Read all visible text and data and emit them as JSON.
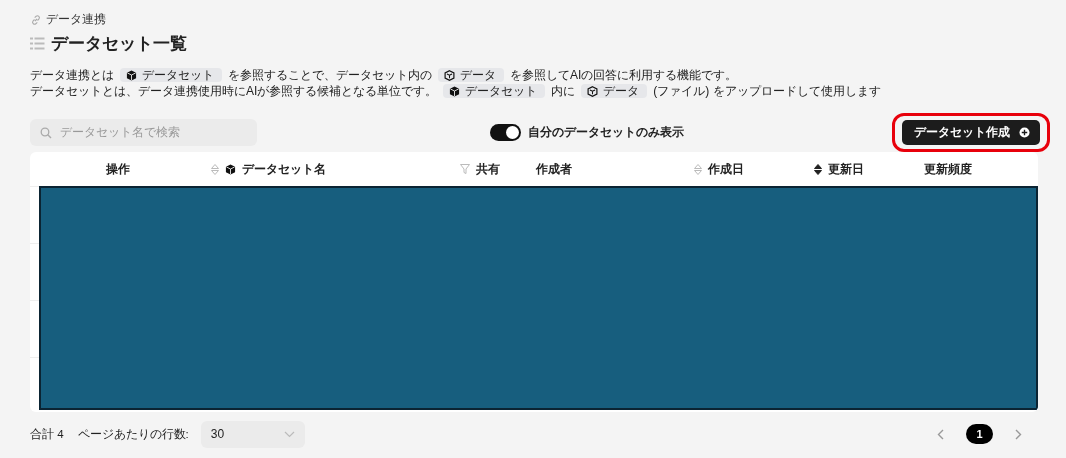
{
  "breadcrumb": "データ連携",
  "title": "データセット一覧",
  "description": [
    [
      {
        "kind": "text",
        "text": "データ連携とは"
      },
      {
        "kind": "dataset",
        "text": "データセット"
      },
      {
        "kind": "text",
        "text": "を参照することで、データセット内の"
      },
      {
        "kind": "data",
        "text": "データ"
      },
      {
        "kind": "text",
        "text": "を参照してAIの回答に利用する機能です。"
      }
    ],
    [
      {
        "kind": "text",
        "text": "データセットとは、データ連携使用時にAIが参照する候補となる単位です。"
      },
      {
        "kind": "dataset",
        "text": "データセット"
      },
      {
        "kind": "text",
        "text": "内に"
      },
      {
        "kind": "data",
        "text": "データ"
      },
      {
        "kind": "text",
        "text": "(ファイル) をアップロードして使用します"
      }
    ]
  ],
  "search": {
    "placeholder": "データセット名で検索"
  },
  "toggle": {
    "label": "自分のデータセットのみ表示",
    "on": true
  },
  "create_button": {
    "label": "データセット作成",
    "highlighted": true
  },
  "table": {
    "columns": [
      {
        "label": "操作",
        "kind": "plain"
      },
      {
        "label": "データセット名",
        "kind": "name",
        "sorted": false
      },
      {
        "label": "共有",
        "kind": "plain"
      },
      {
        "label": "作成者",
        "kind": "plain"
      },
      {
        "label": "作成日",
        "kind": "sortable",
        "sorted": false
      },
      {
        "label": "更新日",
        "kind": "sortable",
        "sorted": true
      },
      {
        "label": "更新頻度",
        "kind": "plain"
      }
    ],
    "redacted": true
  },
  "footer": {
    "total": "合計 4",
    "per_page_label": "ページあたりの行数:",
    "per_page": "30",
    "pages": [
      {
        "label": "1",
        "selected": true
      }
    ]
  }
}
